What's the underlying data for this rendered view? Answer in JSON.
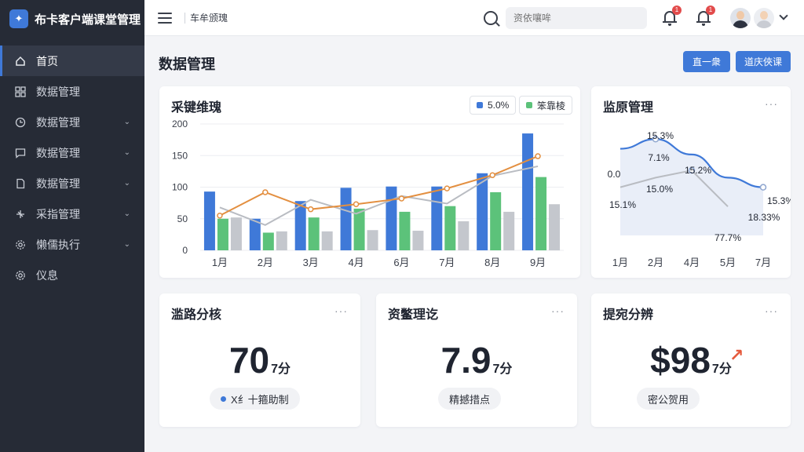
{
  "app": {
    "title": "布卡客户端课堂管理",
    "logo_icon": "brand-logo-icon"
  },
  "sidebar": {
    "items": [
      {
        "label": "首页",
        "icon": "home-icon",
        "active": true,
        "has_submenu": false
      },
      {
        "label": "数据管理",
        "icon": "grid-icon",
        "active": false,
        "has_submenu": false
      },
      {
        "label": "数据管理",
        "icon": "clock-icon",
        "active": false,
        "has_submenu": true
      },
      {
        "label": "数据管理",
        "icon": "message-icon",
        "active": false,
        "has_submenu": true
      },
      {
        "label": "数据管理",
        "icon": "document-icon",
        "active": false,
        "has_submenu": true
      },
      {
        "label": "采指管理",
        "icon": "tools-icon",
        "active": false,
        "has_submenu": true
      },
      {
        "label": "懒儒执行",
        "icon": "gear-icon",
        "active": false,
        "has_submenu": true
      },
      {
        "label": "仪息",
        "icon": "settings-icon",
        "active": false,
        "has_submenu": false
      }
    ]
  },
  "topbar": {
    "breadcrumb": "车牟颁瑰",
    "search_placeholder": "资依嚷哞",
    "notifications": [
      {
        "count": "1"
      },
      {
        "count": "1"
      }
    ]
  },
  "main": {
    "title": "数据管理",
    "buttons": [
      "直一衆",
      "道庆俠课"
    ]
  },
  "cards": {
    "trend": {
      "title": "采键维瑰",
      "legend": [
        {
          "label": "5.0%",
          "color": "#3f79d8"
        },
        {
          "label": "笨靠棱",
          "color": "#5cc27a"
        }
      ],
      "more": "···"
    },
    "quality": {
      "title": "监原管理",
      "more": "···"
    },
    "stat1": {
      "title": "滥路分核",
      "value": "70",
      "unit": "7分",
      "pill": "X纟十箍助制",
      "more": "···"
    },
    "stat2": {
      "title": "资鳖理讫",
      "value": "7.9",
      "unit": "7分",
      "pill": "精撼措点",
      "more": "···"
    },
    "stat3": {
      "title": "提宛分辨",
      "value": "$98",
      "unit": "7分",
      "pill": "密公贺用",
      "trend_icon": "arrow-up-right-icon",
      "trend_color": "#e55a3c",
      "more": "···"
    }
  },
  "chart_data": [
    {
      "type": "bar",
      "categories": [
        "1月",
        "2月",
        "3月",
        "4月",
        "6月",
        "7月",
        "8月",
        "9月"
      ],
      "ylim": [
        0,
        200
      ],
      "y_ticks": [
        "0",
        "50",
        "100",
        "150",
        "200"
      ],
      "y_tick_values": [
        0,
        50,
        100,
        150,
        200
      ],
      "grid": true,
      "series": [
        {
          "values": [
            93,
            50,
            78,
            99,
            101,
            101,
            122,
            185
          ],
          "color": "#3f79d8",
          "kind": "bar"
        },
        {
          "name": "笨靠棱",
          "values": [
            50,
            28,
            52,
            66,
            61,
            70,
            92,
            116
          ],
          "color": "#5cc27a",
          "kind": "bar"
        },
        {
          "values": [
            52,
            30,
            30,
            32,
            31,
            46,
            61,
            73
          ],
          "color": "#c4c7cd",
          "kind": "bar"
        },
        {
          "values": [
            55,
            92,
            65,
            73,
            82,
            98,
            119,
            149
          ],
          "color": "#e38f40",
          "kind": "line"
        },
        {
          "values": [
            68,
            40,
            80,
            58,
            86,
            74,
            118,
            133
          ],
          "color": "#b9bcc2",
          "kind": "line"
        }
      ]
    },
    {
      "type": "area",
      "categories": [
        "1月",
        "2月",
        "4月",
        "5月",
        "7月"
      ],
      "series": [
        {
          "values": [
            18.0,
            20.0,
            16.8,
            12.0,
            10.0
          ],
          "color": "#3f79d8",
          "kind": "area-line"
        },
        {
          "values": [
            10.0,
            12.0,
            13.5,
            6.0
          ],
          "color": "#b9bcc2",
          "kind": "line"
        }
      ],
      "labels": [
        "15.3%",
        "7.1%",
        "0.0",
        "15.0%",
        "15.2%",
        "15.1%",
        "15.3%",
        "18.33%",
        "77.7%"
      ]
    }
  ]
}
